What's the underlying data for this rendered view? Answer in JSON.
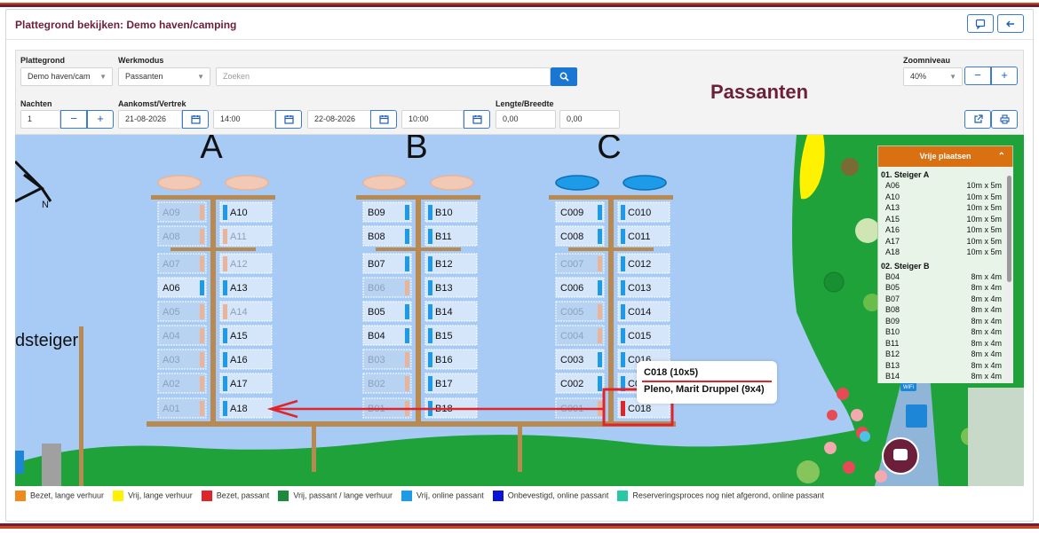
{
  "page": {
    "title": "Plattegrond bekijken: Demo haven/camping"
  },
  "header_buttons": {
    "comment_icon": "comment-icon",
    "back_icon": "arrow-left-icon"
  },
  "filters": {
    "plattegrond_label": "Plattegrond",
    "plattegrond_value": "Demo haven/cam",
    "werkmodus_label": "Werkmodus",
    "werkmodus_value": "Passanten",
    "search_placeholder": "Zoeken",
    "zoom_label": "Zoomniveau",
    "zoom_value": "40%",
    "nachten_label": "Nachten",
    "nachten_value": "1",
    "aankomst_label": "Aankomst/Vertrek",
    "arrival_date": "21-08-2026",
    "arrival_time": "14:00",
    "departure_date": "22-08-2026",
    "departure_time": "10:00",
    "lengte_label": "Lengte/Breedte",
    "lengte_value": "0,00",
    "breedte_value": "0,00",
    "minus": "−",
    "plus": "+"
  },
  "mode_heading": "Passanten",
  "map": {
    "piers": [
      {
        "label": "A",
        "left": [
          "A09",
          "A08",
          "A07",
          "A06",
          "A05",
          "A04",
          "A03",
          "A02",
          "A01"
        ],
        "right": [
          "A10",
          "A11",
          "A12",
          "A13",
          "A14",
          "A15",
          "A16",
          "A17",
          "A18"
        ]
      },
      {
        "label": "B",
        "left": [
          "B09",
          "B08",
          "B07",
          "B06",
          "B05",
          "B04",
          "B03",
          "B02",
          "B01"
        ],
        "right": [
          "B10",
          "B11",
          "B12",
          "B13",
          "B14",
          "B15",
          "B16",
          "B17",
          "B18"
        ]
      },
      {
        "label": "C",
        "left": [
          "C009",
          "C008",
          "C007",
          "C006",
          "C005",
          "C004",
          "C003",
          "C002",
          "C001"
        ],
        "right": [
          "C010",
          "C011",
          "C012",
          "C013",
          "C014",
          "C015",
          "C016",
          "C017",
          "C018"
        ]
      }
    ],
    "side_text": "dsteiger",
    "compass": "N",
    "wifi_label": "WiFi"
  },
  "colors": {
    "water": "#a7cbf5",
    "land": "#1fa23a",
    "jetty": "#b88a52",
    "online": "#1e9be8",
    "busy_passant": "#e0252a",
    "busy_long": "#e8b49a",
    "red_arrow": "#e0252a"
  },
  "vrije_plaatsen": {
    "title": "Vrije plaatsen",
    "groups": [
      {
        "name": "01. Steiger A",
        "rows": [
          {
            "id": "A06",
            "dim": "10m x 5m"
          },
          {
            "id": "A10",
            "dim": "10m x 5m"
          },
          {
            "id": "A13",
            "dim": "10m x 5m"
          },
          {
            "id": "A15",
            "dim": "10m x 5m"
          },
          {
            "id": "A16",
            "dim": "10m x 5m"
          },
          {
            "id": "A17",
            "dim": "10m x 5m"
          },
          {
            "id": "A18",
            "dim": "10m x 5m"
          }
        ]
      },
      {
        "name": "02. Steiger B",
        "rows": [
          {
            "id": "B04",
            "dim": "8m x 4m"
          },
          {
            "id": "B05",
            "dim": "8m x 4m"
          },
          {
            "id": "B07",
            "dim": "8m x 4m"
          },
          {
            "id": "B08",
            "dim": "8m x 4m"
          },
          {
            "id": "B09",
            "dim": "8m x 4m"
          },
          {
            "id": "B10",
            "dim": "8m x 4m"
          },
          {
            "id": "B11",
            "dim": "8m x 4m"
          },
          {
            "id": "B12",
            "dim": "8m x 4m"
          },
          {
            "id": "B13",
            "dim": "8m x 4m"
          },
          {
            "id": "B14",
            "dim": "8m x 4m"
          }
        ]
      }
    ]
  },
  "tooltip": {
    "line1": "C018 (10x5)",
    "line2": "Pleno, Marit Druppel (9x4)"
  },
  "legend": [
    {
      "color": "#f08a1c",
      "label": "Bezet, lange verhuur"
    },
    {
      "color": "#fff200",
      "label": "Vrij, lange verhuur"
    },
    {
      "color": "#e0252a",
      "label": "Bezet, passant"
    },
    {
      "color": "#1b8a3b",
      "label": "Vrij, passant / lange verhuur"
    },
    {
      "color": "#1e9be8",
      "label": "Vrij, online passant"
    },
    {
      "color": "#0a14d8",
      "label": "Onbevestigd, online passant"
    },
    {
      "color": "#25c9a2",
      "label": "Reserveringsproces nog niet afgerond, online passant"
    }
  ]
}
